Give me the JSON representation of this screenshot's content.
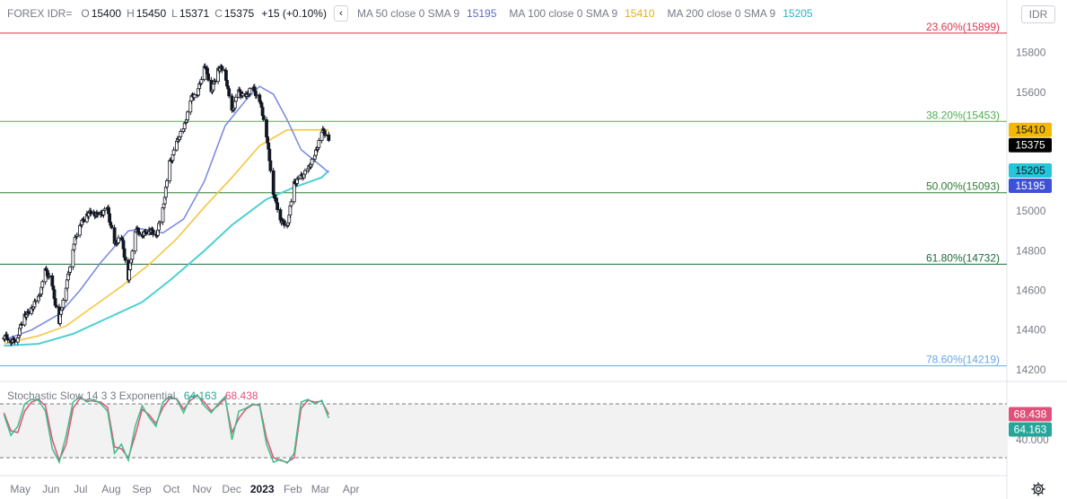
{
  "header": {
    "symbol": "FOREX IDR=",
    "open_key": "O",
    "open": "15400",
    "high_key": "H",
    "high": "15450",
    "low_key": "L",
    "low": "15371",
    "close_key": "C",
    "close": "15375",
    "change": "+15 (+0.10%)",
    "collapse_icon": "chevron-left-icon",
    "ma50_label": "MA 50 close 0 SMA 9",
    "ma50_value": "15195",
    "ma100_label": "MA 100 close 0 SMA 9",
    "ma100_value": "15410",
    "ma200_label": "MA 200 close 0 SMA 9",
    "ma200_value": "15205"
  },
  "currency_button": "IDR",
  "settings_icon": "gear-icon",
  "colors": {
    "ma50": "#7e8ce0",
    "ma100": "#f5c542",
    "ma200": "#4dd0d1",
    "fib_236": "#e0334d",
    "fib_382": "#4caf50",
    "fib_500": "#2e7d32",
    "fib_618": "#1b6b3a",
    "fib_786": "#64a8e8",
    "stoch_k": "#3dbf8a",
    "stoch_d": "#e0517a"
  },
  "chart_data": [
    {
      "type": "candlestick",
      "title": "FOREX IDR=",
      "x_axis_labels": [
        "May",
        "Jun",
        "Jul",
        "Aug",
        "Sep",
        "Oct",
        "Nov",
        "Dec",
        "2023",
        "Feb",
        "Mar",
        "Apr"
      ],
      "y_ticks": [
        "14200",
        "14400",
        "14600",
        "14800",
        "15000",
        "15200",
        "15400",
        "15600",
        "15800"
      ],
      "ylim": [
        14140,
        15930
      ],
      "close_path": [
        {
          "d": "2022-04-18",
          "v": 14360
        },
        {
          "d": "2022-04-25",
          "v": 14350
        },
        {
          "d": "2022-05-02",
          "v": 14360
        },
        {
          "d": "2022-05-09",
          "v": 14480
        },
        {
          "d": "2022-05-16",
          "v": 14500
        },
        {
          "d": "2022-05-23",
          "v": 14560
        },
        {
          "d": "2022-05-30",
          "v": 14700
        },
        {
          "d": "2022-06-06",
          "v": 14620
        },
        {
          "d": "2022-06-13",
          "v": 14440
        },
        {
          "d": "2022-06-20",
          "v": 14620
        },
        {
          "d": "2022-06-27",
          "v": 14820
        },
        {
          "d": "2022-07-04",
          "v": 14930
        },
        {
          "d": "2022-07-11",
          "v": 14990
        },
        {
          "d": "2022-07-18",
          "v": 14980
        },
        {
          "d": "2022-07-25",
          "v": 14990
        },
        {
          "d": "2022-08-01",
          "v": 15000
        },
        {
          "d": "2022-08-08",
          "v": 14840
        },
        {
          "d": "2022-08-15",
          "v": 14860
        },
        {
          "d": "2022-08-22",
          "v": 14670
        },
        {
          "d": "2022-08-29",
          "v": 14900
        },
        {
          "d": "2022-09-05",
          "v": 14890
        },
        {
          "d": "2022-09-12",
          "v": 14900
        },
        {
          "d": "2022-09-19",
          "v": 14880
        },
        {
          "d": "2022-09-26",
          "v": 15000
        },
        {
          "d": "2022-10-03",
          "v": 15250
        },
        {
          "d": "2022-10-10",
          "v": 15340
        },
        {
          "d": "2022-10-17",
          "v": 15420
        },
        {
          "d": "2022-10-24",
          "v": 15560
        },
        {
          "d": "2022-10-31",
          "v": 15600
        },
        {
          "d": "2022-11-07",
          "v": 15740
        },
        {
          "d": "2022-11-14",
          "v": 15610
        },
        {
          "d": "2022-11-21",
          "v": 15720
        },
        {
          "d": "2022-11-28",
          "v": 15700
        },
        {
          "d": "2022-12-05",
          "v": 15500
        },
        {
          "d": "2022-12-12",
          "v": 15600
        },
        {
          "d": "2022-12-19",
          "v": 15580
        },
        {
          "d": "2022-12-26",
          "v": 15620
        },
        {
          "d": "2023-01-02",
          "v": 15570
        },
        {
          "d": "2023-01-09",
          "v": 15380
        },
        {
          "d": "2023-01-16",
          "v": 15100
        },
        {
          "d": "2023-01-23",
          "v": 14950
        },
        {
          "d": "2023-01-30",
          "v": 14930
        },
        {
          "d": "2023-02-06",
          "v": 15130
        },
        {
          "d": "2023-02-13",
          "v": 15180
        },
        {
          "d": "2023-02-20",
          "v": 15200
        },
        {
          "d": "2023-02-27",
          "v": 15290
        },
        {
          "d": "2023-03-06",
          "v": 15400
        },
        {
          "d": "2023-03-13",
          "v": 15375
        }
      ],
      "ma50": [
        {
          "d": "2022-04-18",
          "v": 14350
        },
        {
          "d": "2022-05-16",
          "v": 14400
        },
        {
          "d": "2022-06-13",
          "v": 14480
        },
        {
          "d": "2022-07-04",
          "v": 14600
        },
        {
          "d": "2022-07-25",
          "v": 14740
        },
        {
          "d": "2022-08-08",
          "v": 14820
        },
        {
          "d": "2022-08-22",
          "v": 14900
        },
        {
          "d": "2022-09-05",
          "v": 14910
        },
        {
          "d": "2022-09-26",
          "v": 14890
        },
        {
          "d": "2022-10-17",
          "v": 14960
        },
        {
          "d": "2022-11-07",
          "v": 15150
        },
        {
          "d": "2022-11-28",
          "v": 15430
        },
        {
          "d": "2022-12-19",
          "v": 15560
        },
        {
          "d": "2023-01-02",
          "v": 15630
        },
        {
          "d": "2023-01-16",
          "v": 15590
        },
        {
          "d": "2023-01-30",
          "v": 15460
        },
        {
          "d": "2023-02-13",
          "v": 15310
        },
        {
          "d": "2023-03-06",
          "v": 15225
        },
        {
          "d": "2023-03-13",
          "v": 15195
        }
      ],
      "ma100": [
        {
          "d": "2022-04-18",
          "v": 14330
        },
        {
          "d": "2022-05-23",
          "v": 14370
        },
        {
          "d": "2022-06-20",
          "v": 14420
        },
        {
          "d": "2022-07-18",
          "v": 14520
        },
        {
          "d": "2022-08-15",
          "v": 14620
        },
        {
          "d": "2022-09-12",
          "v": 14730
        },
        {
          "d": "2022-10-10",
          "v": 14860
        },
        {
          "d": "2022-11-07",
          "v": 15020
        },
        {
          "d": "2022-12-05",
          "v": 15170
        },
        {
          "d": "2023-01-02",
          "v": 15330
        },
        {
          "d": "2023-01-30",
          "v": 15410
        },
        {
          "d": "2023-03-06",
          "v": 15410
        },
        {
          "d": "2023-03-13",
          "v": 15410
        }
      ],
      "ma200": [
        {
          "d": "2022-04-18",
          "v": 14320
        },
        {
          "d": "2022-05-23",
          "v": 14330
        },
        {
          "d": "2022-06-27",
          "v": 14380
        },
        {
          "d": "2022-08-01",
          "v": 14460
        },
        {
          "d": "2022-09-05",
          "v": 14540
        },
        {
          "d": "2022-10-03",
          "v": 14650
        },
        {
          "d": "2022-11-07",
          "v": 14800
        },
        {
          "d": "2022-12-05",
          "v": 14930
        },
        {
          "d": "2023-01-09",
          "v": 15060
        },
        {
          "d": "2023-02-06",
          "v": 15120
        },
        {
          "d": "2023-03-06",
          "v": 15170
        },
        {
          "d": "2023-03-13",
          "v": 15205
        }
      ],
      "fibonacci_levels": [
        {
          "label": "23.60%(15899)",
          "value": 15899,
          "color": "#e0334d"
        },
        {
          "label": "38.20%(15453)",
          "value": 15453,
          "color": "#4caf50"
        },
        {
          "label": "50.00%(15093)",
          "value": 15093,
          "color": "#2e7d32"
        },
        {
          "label": "61.80%(14732)",
          "value": 14732,
          "color": "#1b6b3a"
        },
        {
          "label": "78.60%(14219)",
          "value": 14219,
          "color": "#64a8e8"
        }
      ],
      "price_badges": [
        {
          "text": "15410",
          "value": 15410,
          "bg": "#f5b800",
          "fg": "#131722"
        },
        {
          "text": "15375",
          "value": 15375,
          "bg": "#000000",
          "fg": "#ffffff"
        },
        {
          "text": "15205",
          "value": 15205,
          "bg": "#26c6da",
          "fg": "#131722"
        },
        {
          "text": "15195",
          "value": 15195,
          "bg": "#3f51d8",
          "fg": "#ffffff"
        }
      ]
    },
    {
      "type": "line",
      "title": "Stochastic Slow 14 3 3 Exponential",
      "k_value": "64.163",
      "d_value": "68.438",
      "ylim": [
        0,
        100
      ],
      "y_ticks": [
        "40.000"
      ],
      "band": [
        20,
        80
      ],
      "k": [
        {
          "d": "2022-04-18",
          "v": 68
        },
        {
          "d": "2022-04-25",
          "v": 45
        },
        {
          "d": "2022-05-02",
          "v": 55
        },
        {
          "d": "2022-05-09",
          "v": 80
        },
        {
          "d": "2022-05-16",
          "v": 85
        },
        {
          "d": "2022-05-23",
          "v": 84
        },
        {
          "d": "2022-05-30",
          "v": 72
        },
        {
          "d": "2022-06-06",
          "v": 30
        },
        {
          "d": "2022-06-13",
          "v": 15
        },
        {
          "d": "2022-06-20",
          "v": 45
        },
        {
          "d": "2022-06-27",
          "v": 82
        },
        {
          "d": "2022-07-04",
          "v": 88
        },
        {
          "d": "2022-07-11",
          "v": 82
        },
        {
          "d": "2022-07-18",
          "v": 85
        },
        {
          "d": "2022-07-25",
          "v": 80
        },
        {
          "d": "2022-08-01",
          "v": 72
        },
        {
          "d": "2022-08-08",
          "v": 25
        },
        {
          "d": "2022-08-15",
          "v": 35
        },
        {
          "d": "2022-08-22",
          "v": 17
        },
        {
          "d": "2022-08-29",
          "v": 55
        },
        {
          "d": "2022-09-05",
          "v": 78
        },
        {
          "d": "2022-09-12",
          "v": 65
        },
        {
          "d": "2022-09-19",
          "v": 55
        },
        {
          "d": "2022-09-26",
          "v": 82
        },
        {
          "d": "2022-10-03",
          "v": 88
        },
        {
          "d": "2022-10-10",
          "v": 85
        },
        {
          "d": "2022-10-17",
          "v": 70
        },
        {
          "d": "2022-10-24",
          "v": 88
        },
        {
          "d": "2022-10-31",
          "v": 90
        },
        {
          "d": "2022-11-07",
          "v": 78
        },
        {
          "d": "2022-11-14",
          "v": 70
        },
        {
          "d": "2022-11-21",
          "v": 80
        },
        {
          "d": "2022-11-28",
          "v": 88
        },
        {
          "d": "2022-12-05",
          "v": 40
        },
        {
          "d": "2022-12-12",
          "v": 72
        },
        {
          "d": "2022-12-19",
          "v": 75
        },
        {
          "d": "2022-12-26",
          "v": 80
        },
        {
          "d": "2023-01-02",
          "v": 78
        },
        {
          "d": "2023-01-09",
          "v": 35
        },
        {
          "d": "2023-01-16",
          "v": 15
        },
        {
          "d": "2023-01-23",
          "v": 18
        },
        {
          "d": "2023-01-30",
          "v": 14
        },
        {
          "d": "2023-02-06",
          "v": 25
        },
        {
          "d": "2023-02-13",
          "v": 82
        },
        {
          "d": "2023-02-20",
          "v": 85
        },
        {
          "d": "2023-02-27",
          "v": 80
        },
        {
          "d": "2023-03-06",
          "v": 84
        },
        {
          "d": "2023-03-13",
          "v": 64.163
        }
      ],
      "d": [
        {
          "d": "2022-04-18",
          "v": 70
        },
        {
          "d": "2022-04-25",
          "v": 50
        },
        {
          "d": "2022-05-02",
          "v": 48
        },
        {
          "d": "2022-05-09",
          "v": 72
        },
        {
          "d": "2022-05-16",
          "v": 82
        },
        {
          "d": "2022-05-23",
          "v": 85
        },
        {
          "d": "2022-05-30",
          "v": 78
        },
        {
          "d": "2022-06-06",
          "v": 40
        },
        {
          "d": "2022-06-13",
          "v": 17
        },
        {
          "d": "2022-06-20",
          "v": 35
        },
        {
          "d": "2022-06-27",
          "v": 75
        },
        {
          "d": "2022-07-04",
          "v": 86
        },
        {
          "d": "2022-07-11",
          "v": 84
        },
        {
          "d": "2022-07-18",
          "v": 83
        },
        {
          "d": "2022-07-25",
          "v": 82
        },
        {
          "d": "2022-08-01",
          "v": 76
        },
        {
          "d": "2022-08-08",
          "v": 32
        },
        {
          "d": "2022-08-15",
          "v": 30
        },
        {
          "d": "2022-08-22",
          "v": 20
        },
        {
          "d": "2022-08-29",
          "v": 45
        },
        {
          "d": "2022-09-05",
          "v": 74
        },
        {
          "d": "2022-09-12",
          "v": 68
        },
        {
          "d": "2022-09-19",
          "v": 58
        },
        {
          "d": "2022-09-26",
          "v": 76
        },
        {
          "d": "2022-10-03",
          "v": 86
        },
        {
          "d": "2022-10-10",
          "v": 86
        },
        {
          "d": "2022-10-17",
          "v": 74
        },
        {
          "d": "2022-10-24",
          "v": 84
        },
        {
          "d": "2022-10-31",
          "v": 89
        },
        {
          "d": "2022-11-07",
          "v": 82
        },
        {
          "d": "2022-11-14",
          "v": 72
        },
        {
          "d": "2022-11-21",
          "v": 78
        },
        {
          "d": "2022-11-28",
          "v": 86
        },
        {
          "d": "2022-12-05",
          "v": 48
        },
        {
          "d": "2022-12-12",
          "v": 64
        },
        {
          "d": "2022-12-19",
          "v": 74
        },
        {
          "d": "2022-12-26",
          "v": 79
        },
        {
          "d": "2023-01-02",
          "v": 79
        },
        {
          "d": "2023-01-09",
          "v": 42
        },
        {
          "d": "2023-01-16",
          "v": 20
        },
        {
          "d": "2023-01-23",
          "v": 17
        },
        {
          "d": "2023-01-30",
          "v": 15
        },
        {
          "d": "2023-02-06",
          "v": 20
        },
        {
          "d": "2023-02-13",
          "v": 75
        },
        {
          "d": "2023-02-20",
          "v": 84
        },
        {
          "d": "2023-02-27",
          "v": 82
        },
        {
          "d": "2023-03-06",
          "v": 83
        },
        {
          "d": "2023-03-13",
          "v": 68.438
        }
      ]
    }
  ]
}
